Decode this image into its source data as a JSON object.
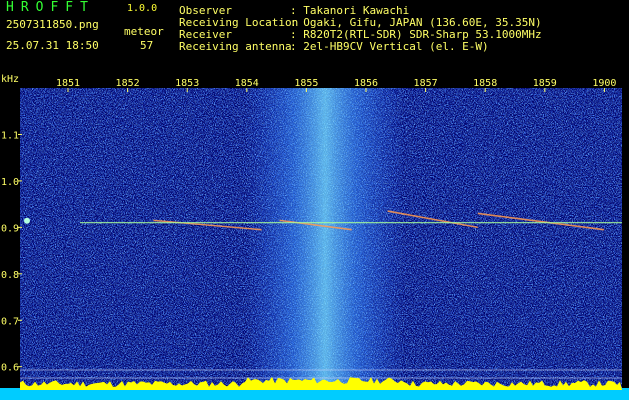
{
  "header": {
    "app_title": "HROFFT",
    "version": "1.0.0",
    "file_name": "2507311850.png",
    "meteor_label": "meteor",
    "timestamp": "25.07.31 18:50",
    "meteor_count": "57",
    "info": [
      {
        "label": "Observer",
        "value": ": Takanori Kawachi"
      },
      {
        "label": "Receiving Location",
        "value": ": Ogaki, Gifu, JAPAN (136.60E, 35.35N)"
      },
      {
        "label": "Receiver",
        "value": ": R820T2(RTL-SDR) SDR-Sharp 53.1000MHz"
      },
      {
        "label": "Receiving antenna",
        "value": ": 2el-HB9CV Vertical (el. E-W)"
      }
    ]
  },
  "colors": {
    "background": "#000000",
    "noise_dark": "#000080",
    "noise_mid": "#0a2fd0",
    "noise_bright": "#40c8ff",
    "text": "#ffff66",
    "title": "#33ff33",
    "bottom_band": "#00ccff",
    "bottom_spikes": "#ffff00"
  },
  "chart_data": {
    "type": "heatmap",
    "title": "",
    "ylabel": "kHz",
    "xlabel": "",
    "x_ticks": [
      "1851",
      "1852",
      "1853",
      "1854",
      "1855",
      "1856",
      "1857",
      "1858",
      "1859",
      "1900"
    ],
    "y_ticks": [
      "1.1",
      "1.0",
      "0.9",
      "0.8",
      "0.7",
      "0.6"
    ],
    "y_tick_values": [
      1.1,
      1.0,
      0.9,
      0.8,
      0.7,
      0.6
    ],
    "xlim": [
      18.833,
      19.0
    ],
    "ylim": [
      0.58,
      1.2
    ],
    "carrier_khz": 0.91,
    "meteor_streaks": [
      {
        "x_start": 18.87,
        "x_end": 18.9,
        "y_start": 0.915,
        "y_end": 0.895
      },
      {
        "x_start": 18.905,
        "x_end": 18.925,
        "y_start": 0.915,
        "y_end": 0.895
      },
      {
        "x_start": 18.935,
        "x_end": 18.96,
        "y_start": 0.935,
        "y_end": 0.9
      },
      {
        "x_start": 18.96,
        "x_end": 18.995,
        "y_start": 0.93,
        "y_end": 0.895
      }
    ]
  }
}
